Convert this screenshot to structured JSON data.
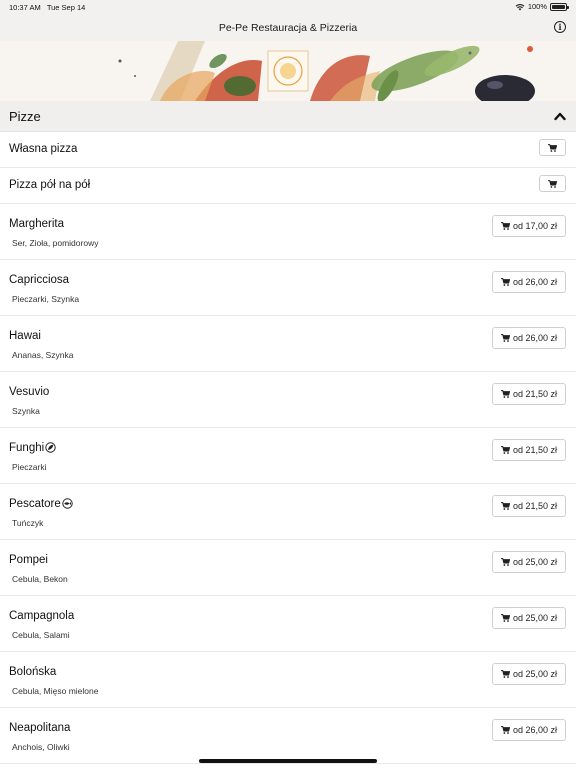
{
  "status_bar": {
    "time": "10:37 AM",
    "date": "Tue Sep 14",
    "battery": "100%"
  },
  "nav": {
    "title": "Pe-Pe Restauracja & Pizzeria"
  },
  "section": {
    "title": "Pizze"
  },
  "items": [
    {
      "name": "Własna pizza"
    },
    {
      "name": "Pizza pół na pół"
    },
    {
      "name": "Margherita",
      "desc": "Ser, Zioła, pomidorowy",
      "price": "od 17,00 zł"
    },
    {
      "name": "Capricciosa",
      "desc": "Pieczarki, Szynka",
      "price": "od 26,00 zł"
    },
    {
      "name": "Hawai",
      "desc": "Ananas, Szynka",
      "price": "od 26,00 zł"
    },
    {
      "name": "Vesuvio",
      "desc": "Szynka",
      "price": "od 21,50 zł"
    },
    {
      "name": "Funghi",
      "desc": "Pieczarki",
      "price": "od 21,50 zł",
      "badge": "vegetarian-icon"
    },
    {
      "name": "Pescatore",
      "desc": "Tuńczyk",
      "price": "od 21,50 zł",
      "badge": "fish-icon"
    },
    {
      "name": "Pompei",
      "desc": "Cebula, Bekon",
      "price": "od 25,00 zł"
    },
    {
      "name": "Campagnola",
      "desc": "Cebula, Salami",
      "price": "od 25,00 zł"
    },
    {
      "name": "Bolońska",
      "desc": "Cebula, Mięso mielone",
      "price": "od 25,00 zł"
    },
    {
      "name": "Neapolitana",
      "desc": "Anchois, Oliwki",
      "price": "od 26,00 zł"
    }
  ]
}
